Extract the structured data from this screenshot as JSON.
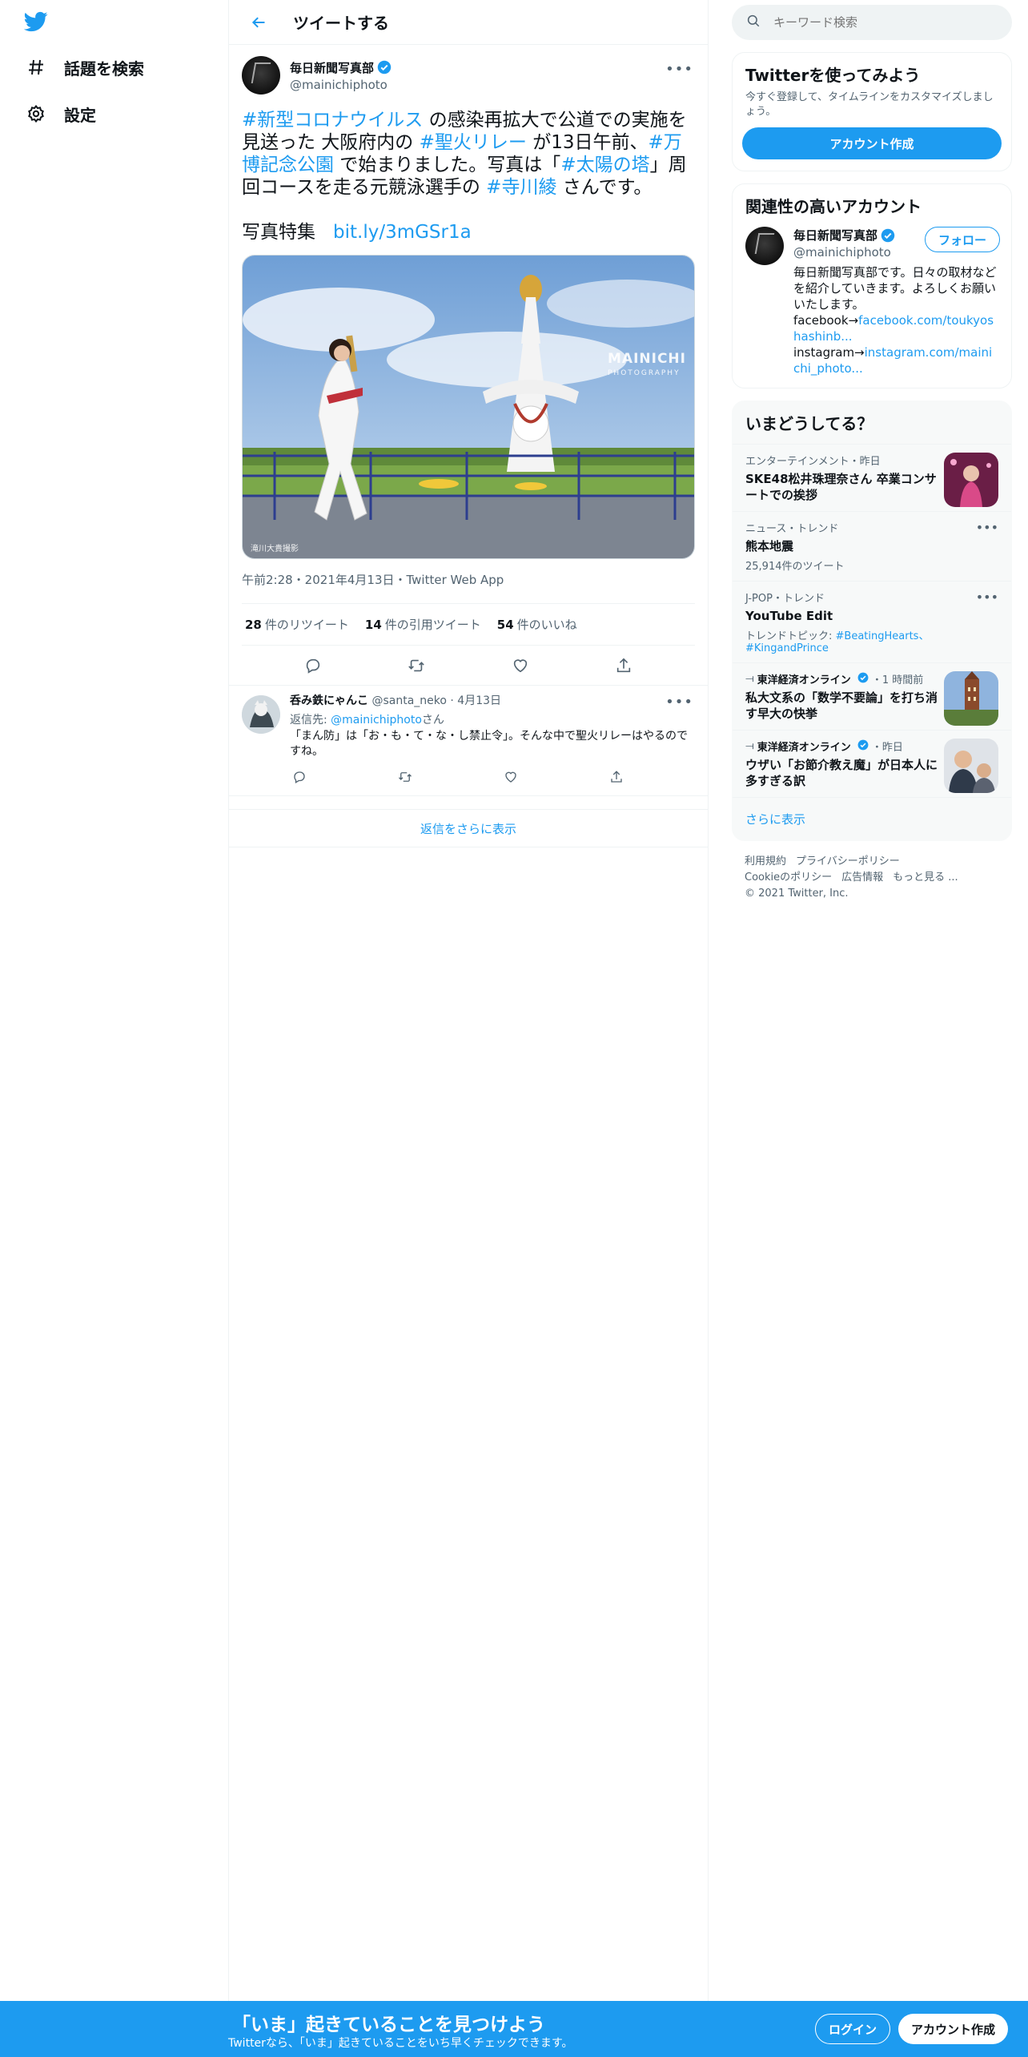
{
  "nav": {
    "explore_label": "話題を検索",
    "settings_label": "設定"
  },
  "header": {
    "title": "ツイートする"
  },
  "tweet": {
    "author_name": "毎日新聞写真部",
    "author_handle": "@mainichiphoto",
    "text_parts": [
      {
        "text": "#新型コロナウイルス",
        "link": true
      },
      {
        "text": " の感染再拡大で公道での実施を見送った 大阪府内の ",
        "link": false
      },
      {
        "text": "#聖火リレー",
        "link": true
      },
      {
        "text": " が13日午前、",
        "link": false
      },
      {
        "text": "#万博記念公園",
        "link": true
      },
      {
        "text": " で始まりました。写真は「",
        "link": false
      },
      {
        "text": "#太陽の塔",
        "link": true
      },
      {
        "text": "」周回コースを走る元競泳選手の ",
        "link": false
      },
      {
        "text": "#寺川綾",
        "link": true
      },
      {
        "text": " さんです。",
        "link": false
      }
    ],
    "photo_label": "写真特集",
    "photo_link": "bit.ly/3mGSr1a",
    "image_watermark": "MAINICHI",
    "image_watermark_sub": "PHOTOGRAPHY",
    "image_credit": "滝川大貴撮影",
    "meta": "午前2:28・2021年4月13日・Twitter Web App",
    "stats": {
      "retweets_count": "28",
      "retweets_label": "件のリツイート",
      "quotes_count": "14",
      "quotes_label": "件の引用ツイート",
      "likes_count": "54",
      "likes_label": "件のいいね"
    }
  },
  "reply": {
    "name": "呑み鉄にゃんこ",
    "handle": "@santa_neko",
    "date": "· 4月13日",
    "reply_to_prefix": "返信先: ",
    "reply_to_handle": "@mainichiphoto",
    "reply_to_suffix": "さん",
    "text": "「まん防」は「お・も・て・な・し禁止令」。そんな中で聖火リレーはやるのですね。"
  },
  "show_more_replies": "返信をさらに表示",
  "sidebar": {
    "search_placeholder": "キーワード検索",
    "signup_card": {
      "title": "Twitterを使ってみよう",
      "subtitle": "今すぐ登録して、タイムラインをカスタマイズしましょう。",
      "button": "アカウント作成"
    },
    "related": {
      "title": "関連性の高いアカウント",
      "name": "毎日新聞写真部",
      "handle": "@mainichiphoto",
      "follow": "フォロー",
      "bio": "毎日新聞写真部です。日々の取材などを紹介していきます。よろしくお願いいたします。",
      "fb_prefix": "facebook→",
      "fb_link": "facebook.com/toukyoshashinb...",
      "ig_prefix": "instagram→",
      "ig_link": "instagram.com/mainichi_photo..."
    },
    "trends": {
      "title": "いまどうしてる？",
      "items": [
        {
          "category": "エンターテインメント・昨日",
          "title": "SKE48松井珠理奈さん 卒業コンサートでの挨拶"
        },
        {
          "category": "ニュース・トレンド",
          "title": "熊本地震",
          "count": "25,914件のツイート"
        },
        {
          "category": "J-POP・トレンド",
          "title": "YouTube Edit",
          "topic_prefix": "トレンドトピック: ",
          "topic_links": "#BeatingHearts、#KingandPrince"
        },
        {
          "source": "東洋経済オンライン",
          "time": "・1 時間前",
          "title": "私大文系の「数学不要論」を打ち消す早大の快挙"
        },
        {
          "source": "東洋経済オンライン",
          "time": "・昨日",
          "title": "ウザい「お節介教え魔」が日本人に多すぎる訳"
        }
      ],
      "show_more": "さらに表示"
    },
    "footer": {
      "links1": [
        "利用規約",
        "プライバシーポリシー"
      ],
      "links2": [
        "Cookieのポリシー",
        "広告情報",
        "もっと見る ..."
      ],
      "copyright": "© 2021 Twitter, Inc."
    }
  },
  "bottom_bar": {
    "title": "「いま」起きていることを見つけよう",
    "subtitle": "Twitterなら、「いま」起きていることをいち早くチェックできます。",
    "login": "ログイン",
    "signup": "アカウント作成"
  },
  "colors": {
    "accent": "#1d9bf0",
    "text": "#0f1419",
    "muted": "#536471"
  }
}
